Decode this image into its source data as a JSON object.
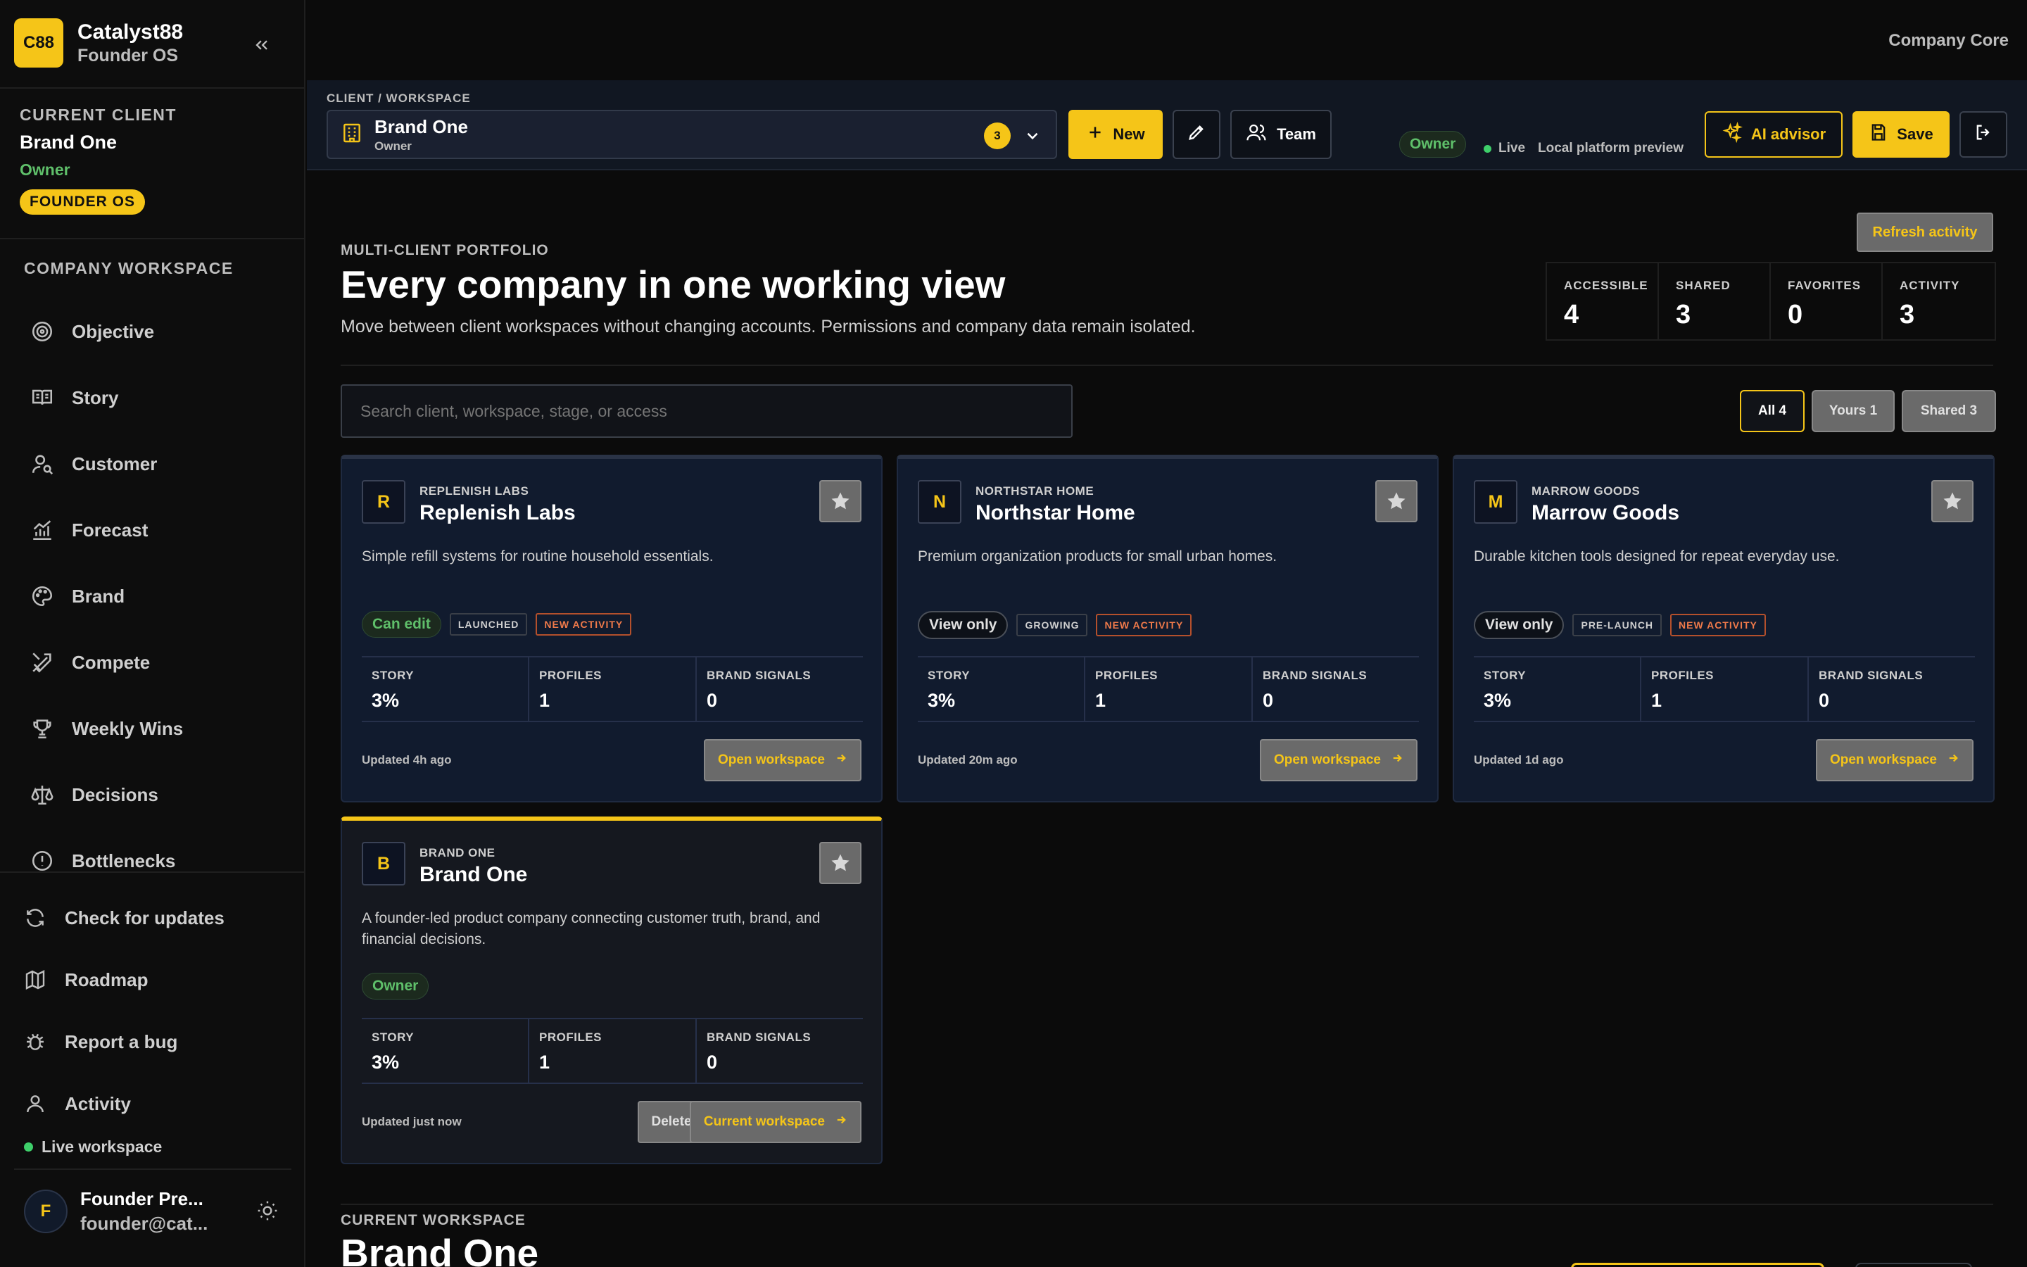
{
  "app": {
    "name": "Catalyst88",
    "sub": "Founder OS",
    "logo": "C88"
  },
  "current_client": {
    "label": "CURRENT CLIENT",
    "name": "Brand One",
    "role": "Owner",
    "badge": "FOUNDER OS"
  },
  "nav": {
    "section_label": "COMPANY WORKSPACE",
    "items": [
      {
        "label": "Objective",
        "icon": "target-icon"
      },
      {
        "label": "Story",
        "icon": "book-icon"
      },
      {
        "label": "Customer",
        "icon": "user-search-icon"
      },
      {
        "label": "Forecast",
        "icon": "chart-icon"
      },
      {
        "label": "Brand",
        "icon": "palette-icon"
      },
      {
        "label": "Compete",
        "icon": "swords-icon"
      },
      {
        "label": "Weekly Wins",
        "icon": "trophy-icon"
      },
      {
        "label": "Decisions",
        "icon": "scale-icon"
      },
      {
        "label": "Bottlenecks",
        "icon": "alert-circle-icon"
      }
    ]
  },
  "util": {
    "items": [
      {
        "label": "Check for updates",
        "icon": "refresh-icon"
      },
      {
        "label": "Roadmap",
        "icon": "map-icon"
      },
      {
        "label": "Report a bug",
        "icon": "bug-icon"
      },
      {
        "label": "Activity",
        "icon": "user-icon"
      }
    ],
    "live_workspace": "Live workspace"
  },
  "user": {
    "initial": "F",
    "name": "Founder Pre...",
    "email": "founder@cat..."
  },
  "topbar": {
    "company_core": "Company Core"
  },
  "toolbar": {
    "label": "CLIENT / WORKSPACE",
    "client_name": "Brand One",
    "client_role": "Owner",
    "client_count": "3",
    "new_label": "New",
    "team_label": "Team",
    "owner_pill": "Owner",
    "live_label": "Live",
    "preview_label": "Local platform preview",
    "ai_label": "AI advisor",
    "save_label": "Save"
  },
  "colors": {
    "accent": "#f5c518",
    "positive": "#5fbf6a",
    "new_activity": "#f07a4a",
    "panel": "#111b2e"
  },
  "portfolio": {
    "refresh_label": "Refresh activity",
    "eyebrow": "MULTI-CLIENT PORTFOLIO",
    "headline": "Every company in one working view",
    "subhead": "Move between client workspaces without changing accounts. Permissions and company data remain isolated.",
    "stats": [
      {
        "label": "ACCESSIBLE",
        "value": "4"
      },
      {
        "label": "SHARED",
        "value": "3"
      },
      {
        "label": "FAVORITES",
        "value": "0"
      },
      {
        "label": "ACTIVITY",
        "value": "3"
      }
    ],
    "search_placeholder": "Search client, workspace, stage, or access",
    "filters": [
      "All 4",
      "Yours 1",
      "Shared 3"
    ]
  },
  "cards": [
    {
      "mark": "R",
      "kicker": "REPLENISH LABS",
      "title": "Replenish Labs",
      "desc": "Simple refill systems for routine household essentials.",
      "access": "Can edit",
      "stage": "LAUNCHED",
      "new_tag": "NEW ACTIVITY",
      "metrics": [
        {
          "label": "STORY",
          "value": "3%"
        },
        {
          "label": "PROFILES",
          "value": "1"
        },
        {
          "label": "BRAND SIGNALS",
          "value": "0"
        }
      ],
      "updated": "Updated 4h ago",
      "action": "Open workspace"
    },
    {
      "mark": "N",
      "kicker": "NORTHSTAR HOME",
      "title": "Northstar Home",
      "desc": "Premium organization products for small urban homes.",
      "access": "View only",
      "stage": "GROWING",
      "new_tag": "NEW ACTIVITY",
      "metrics": [
        {
          "label": "STORY",
          "value": "3%"
        },
        {
          "label": "PROFILES",
          "value": "1"
        },
        {
          "label": "BRAND SIGNALS",
          "value": "0"
        }
      ],
      "updated": "Updated 20m ago",
      "action": "Open workspace"
    },
    {
      "mark": "M",
      "kicker": "MARROW GOODS",
      "title": "Marrow Goods",
      "desc": "Durable kitchen tools designed for repeat everyday use.",
      "access": "View only",
      "stage": "PRE-LAUNCH",
      "new_tag": "NEW ACTIVITY",
      "metrics": [
        {
          "label": "STORY",
          "value": "3%"
        },
        {
          "label": "PROFILES",
          "value": "1"
        },
        {
          "label": "BRAND SIGNALS",
          "value": "0"
        }
      ],
      "updated": "Updated 1d ago",
      "action": "Open workspace"
    },
    {
      "mark": "B",
      "kicker": "BRAND ONE",
      "title": "Brand One",
      "desc": "A founder-led product company connecting customer truth, brand, and financial decisions.",
      "access": "Owner",
      "metrics": [
        {
          "label": "STORY",
          "value": "3%"
        },
        {
          "label": "PROFILES",
          "value": "1"
        },
        {
          "label": "BRAND SIGNALS",
          "value": "0"
        }
      ],
      "updated": "Updated just now",
      "delete": "Delete",
      "action": "Current workspace"
    }
  ],
  "current_workspace": {
    "label": "CURRENT WORKSPACE",
    "title": "Brand One"
  }
}
